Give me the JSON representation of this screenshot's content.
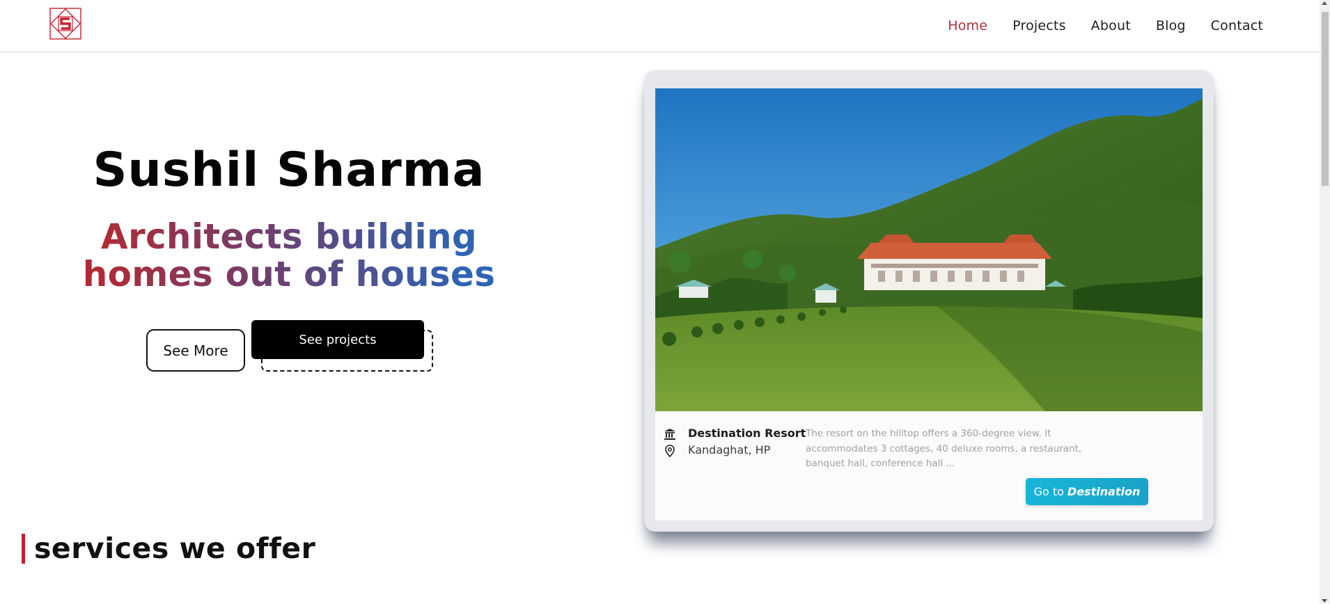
{
  "brand": {
    "logo_icon": "s-diamond-logo-icon",
    "accent": "#c8202d"
  },
  "nav": {
    "items": [
      {
        "label": "Home",
        "active": true
      },
      {
        "label": "Projects",
        "active": false
      },
      {
        "label": "About",
        "active": false
      },
      {
        "label": "Blog",
        "active": false
      },
      {
        "label": "Contact",
        "active": false
      }
    ],
    "active_color": "#a7303b"
  },
  "hero": {
    "name": "Sushil Sharma",
    "tagline_line1": "Architects building",
    "tagline_line2": "homes out of houses",
    "see_more_label": "See More",
    "see_projects_label": "See projects",
    "gradient": [
      "#b02b35",
      "#6e3f6e",
      "#2f63b4"
    ]
  },
  "project_card": {
    "name": "Destination Resort",
    "location": "Kandaghat, HP",
    "description": "The resort on the hilltop offers a 360-degree view. It accommodates 3 cottages, 40 deluxe rooms, a restaurant, banquet hall, conference hall ...",
    "cta_prefix": "Go to",
    "cta_emphasis": "Destination",
    "cta_color": "#18b5d8",
    "building_icon": "building-icon",
    "location_icon": "location-pin-icon"
  },
  "services": {
    "title": "services we offer"
  }
}
